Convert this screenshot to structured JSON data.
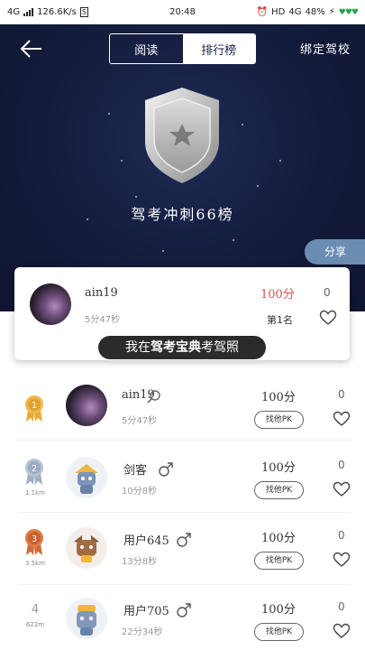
{
  "status_bar": {
    "network": "4G",
    "speed": "126.6K/s",
    "sim_badge": "S",
    "time": "20:48",
    "hd": "HD",
    "net2": "4G",
    "battery": "48%"
  },
  "header": {
    "tabs": [
      {
        "label": "阅读",
        "active": false
      },
      {
        "label": "排行榜",
        "active": true
      }
    ],
    "bind_school": "绑定驾校",
    "title": "驾考冲刺66榜",
    "share": "分享"
  },
  "my_card": {
    "name": "ain19",
    "time": "5分47秒",
    "score": "100分",
    "likes": "0",
    "rank": "第1名",
    "banner_pre": "我在",
    "banner_brand": "驾考宝典",
    "banner_post": "考驾照"
  },
  "list": [
    {
      "rank": "1",
      "distance": "",
      "name": "ain19",
      "gender": "search",
      "time": "5分47秒",
      "score": "100分",
      "likes": "0",
      "pk": "找他PK"
    },
    {
      "rank": "2",
      "distance": "1.1km",
      "name": "剑客",
      "gender": "male",
      "time": "10分8秒",
      "score": "100分",
      "likes": "0",
      "pk": "找他PK"
    },
    {
      "rank": "3",
      "distance": "3.5km",
      "name": "用户645",
      "gender": "male",
      "time": "13分8秒",
      "score": "100分",
      "likes": "0",
      "pk": "找他PK"
    },
    {
      "rank": "4",
      "distance": "622m",
      "name": "用户705",
      "gender": "male",
      "time": "22分34秒",
      "score": "100分",
      "likes": "0",
      "pk": "找他PK"
    }
  ],
  "colors": {
    "hero_bg": "#141c3c",
    "score_red": "#d9534f",
    "gold": "#e8a93a",
    "silver": "#9fb0c4",
    "bronze": "#d06a3a",
    "share_bg": "#6b8db2"
  }
}
